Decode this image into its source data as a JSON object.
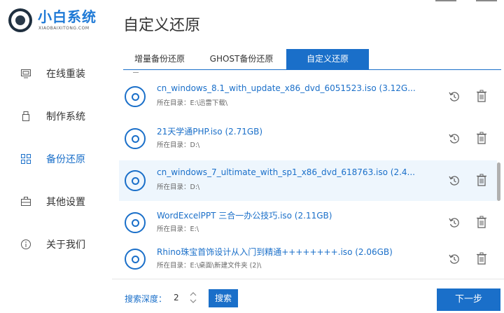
{
  "app": {
    "logo_title": "小白系统",
    "logo_sub": "XIAOBAIXITONG.COM"
  },
  "page_title": "自定义还原",
  "sidebar": {
    "items": [
      {
        "label": "在线重装",
        "icon": "monitor-icon"
      },
      {
        "label": "制作系统",
        "icon": "usb-drive-icon"
      },
      {
        "label": "备份还原",
        "icon": "grid-icon",
        "active": true
      },
      {
        "label": "其他设置",
        "icon": "briefcase-icon"
      },
      {
        "label": "关于我们",
        "icon": "info-icon"
      }
    ]
  },
  "tabs": [
    {
      "label": "增量备份还原"
    },
    {
      "label": "GHOST备份还原"
    },
    {
      "label": "自定义还原",
      "active": true
    }
  ],
  "files": [
    {
      "name": "cn_windows_8.1_with_update_x86_dvd_6051523.iso (3.12G...",
      "dir": "所在目录：E:\\迅雷下载\\"
    },
    {
      "name": "21天学通PHP.iso (2.71GB)",
      "dir": "所在目录：D:\\"
    },
    {
      "name": "cn_windows_7_ultimate_with_sp1_x86_dvd_618763.iso (2.4...",
      "dir": "所在目录：D:\\",
      "highlight": true
    },
    {
      "name": "WordExcelPPT 三合一办公技巧.iso (2.11GB)",
      "dir": "所在目录：E:\\"
    },
    {
      "name": "Rhino珠宝首饰设计从入门到精通++++++++.iso (2.06GB)",
      "dir": "所在目录：E:\\桌面\\新建文件夹 (2)\\"
    }
  ],
  "bottom": {
    "depth_label": "搜索深度：",
    "depth_value": "2",
    "search_label": "搜索",
    "next_label": "下一步"
  },
  "colors": {
    "accent": "#1a6fc9",
    "highlight_row": "#eef6fd"
  }
}
